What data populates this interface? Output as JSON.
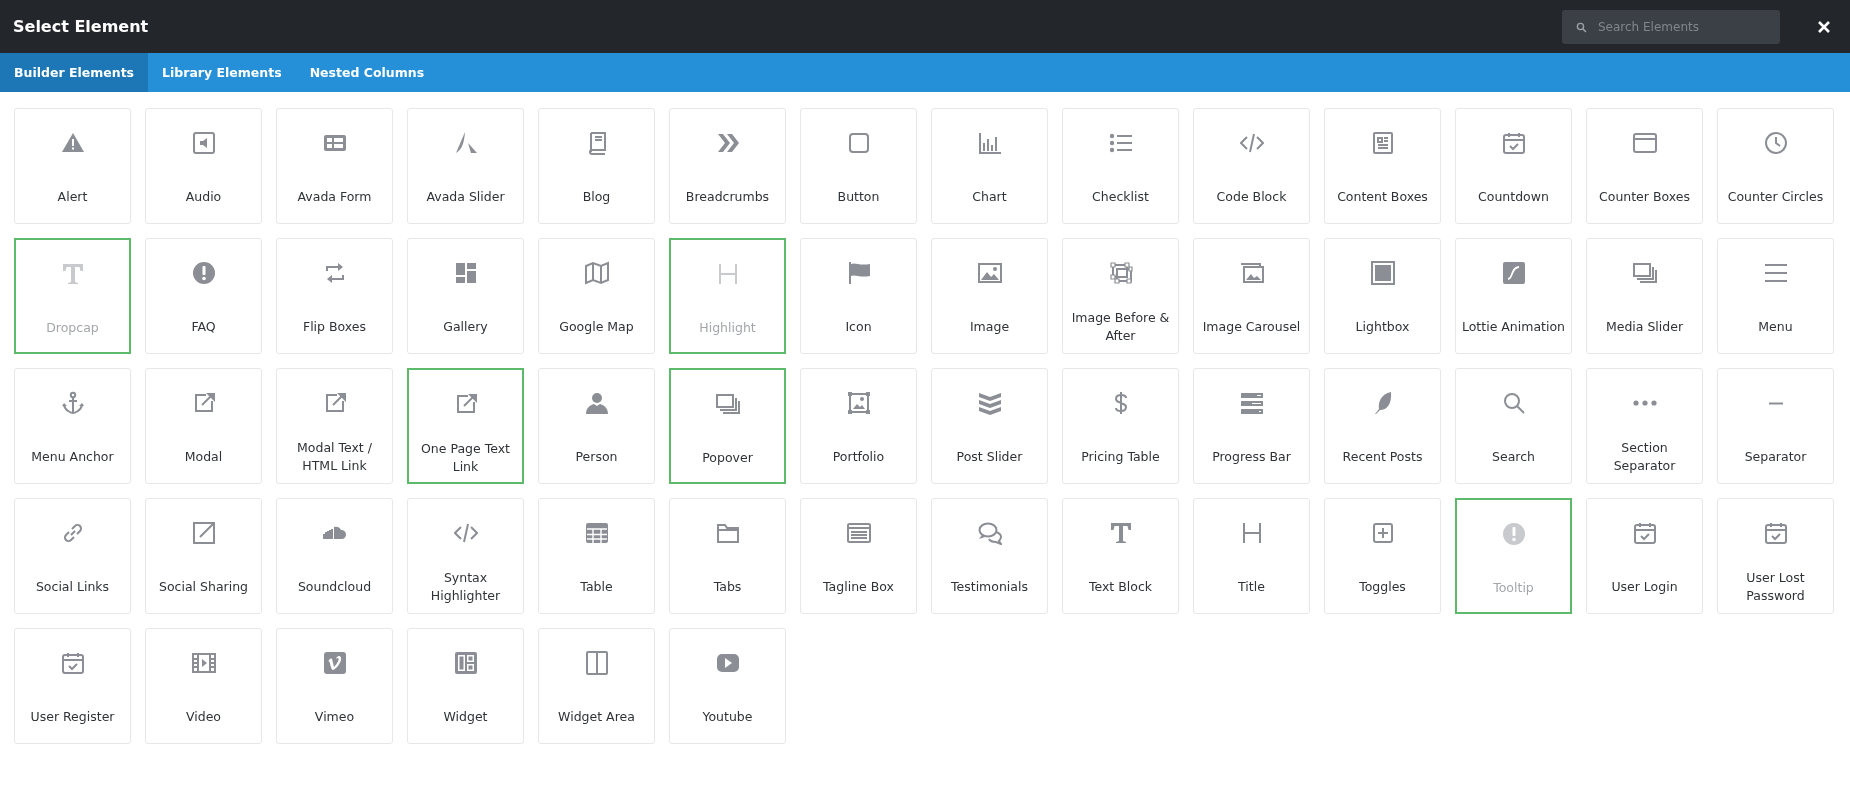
{
  "window": {
    "title": "Select Element"
  },
  "search": {
    "placeholder": "Search Elements"
  },
  "tabs": [
    {
      "label": "Builder Elements",
      "selected": true
    },
    {
      "label": "Library Elements",
      "selected": false
    },
    {
      "label": "Nested Columns",
      "selected": false
    }
  ],
  "elements": [
    {
      "label": "Alert",
      "disabled": false,
      "highlighted": false
    },
    {
      "label": "Audio",
      "disabled": false,
      "highlighted": false
    },
    {
      "label": "Avada Form",
      "disabled": false,
      "highlighted": false
    },
    {
      "label": "Avada Slider",
      "disabled": false,
      "highlighted": false
    },
    {
      "label": "Blog",
      "disabled": false,
      "highlighted": false
    },
    {
      "label": "Breadcrumbs",
      "disabled": false,
      "highlighted": false
    },
    {
      "label": "Button",
      "disabled": false,
      "highlighted": false
    },
    {
      "label": "Chart",
      "disabled": false,
      "highlighted": false
    },
    {
      "label": "Checklist",
      "disabled": false,
      "highlighted": false
    },
    {
      "label": "Code Block",
      "disabled": false,
      "highlighted": false
    },
    {
      "label": "Content Boxes",
      "disabled": false,
      "highlighted": false
    },
    {
      "label": "Countdown",
      "disabled": false,
      "highlighted": false
    },
    {
      "label": "Counter Boxes",
      "disabled": false,
      "highlighted": false
    },
    {
      "label": "Counter Circles",
      "disabled": false,
      "highlighted": false
    },
    {
      "label": "Dropcap",
      "disabled": true,
      "highlighted": true
    },
    {
      "label": "FAQ",
      "disabled": false,
      "highlighted": false
    },
    {
      "label": "Flip Boxes",
      "disabled": false,
      "highlighted": false
    },
    {
      "label": "Gallery",
      "disabled": false,
      "highlighted": false
    },
    {
      "label": "Google Map",
      "disabled": false,
      "highlighted": false
    },
    {
      "label": "Highlight",
      "disabled": true,
      "highlighted": true
    },
    {
      "label": "Icon",
      "disabled": false,
      "highlighted": false
    },
    {
      "label": "Image",
      "disabled": false,
      "highlighted": false
    },
    {
      "label": "Image Before & After",
      "disabled": false,
      "highlighted": false
    },
    {
      "label": "Image Carousel",
      "disabled": false,
      "highlighted": false
    },
    {
      "label": "Lightbox",
      "disabled": false,
      "highlighted": false
    },
    {
      "label": "Lottie Animation",
      "disabled": false,
      "highlighted": false
    },
    {
      "label": "Media Slider",
      "disabled": false,
      "highlighted": false
    },
    {
      "label": "Menu",
      "disabled": false,
      "highlighted": false
    },
    {
      "label": "Menu Anchor",
      "disabled": false,
      "highlighted": false
    },
    {
      "label": "Modal",
      "disabled": false,
      "highlighted": false
    },
    {
      "label": "Modal Text / HTML Link",
      "disabled": false,
      "highlighted": false
    },
    {
      "label": "One Page Text Link",
      "disabled": false,
      "highlighted": true
    },
    {
      "label": "Person",
      "disabled": false,
      "highlighted": false
    },
    {
      "label": "Popover",
      "disabled": false,
      "highlighted": true
    },
    {
      "label": "Portfolio",
      "disabled": false,
      "highlighted": false
    },
    {
      "label": "Post Slider",
      "disabled": false,
      "highlighted": false
    },
    {
      "label": "Pricing Table",
      "disabled": false,
      "highlighted": false
    },
    {
      "label": "Progress Bar",
      "disabled": false,
      "highlighted": false
    },
    {
      "label": "Recent Posts",
      "disabled": false,
      "highlighted": false
    },
    {
      "label": "Search",
      "disabled": false,
      "highlighted": false
    },
    {
      "label": "Section Separator",
      "disabled": false,
      "highlighted": false
    },
    {
      "label": "Separator",
      "disabled": false,
      "highlighted": false
    },
    {
      "label": "Social Links",
      "disabled": false,
      "highlighted": false
    },
    {
      "label": "Social Sharing",
      "disabled": false,
      "highlighted": false
    },
    {
      "label": "Soundcloud",
      "disabled": false,
      "highlighted": false
    },
    {
      "label": "Syntax Highlighter",
      "disabled": false,
      "highlighted": false
    },
    {
      "label": "Table",
      "disabled": false,
      "highlighted": false
    },
    {
      "label": "Tabs",
      "disabled": false,
      "highlighted": false
    },
    {
      "label": "Tagline Box",
      "disabled": false,
      "highlighted": false
    },
    {
      "label": "Testimonials",
      "disabled": false,
      "highlighted": false
    },
    {
      "label": "Text Block",
      "disabled": false,
      "highlighted": false
    },
    {
      "label": "Title",
      "disabled": false,
      "highlighted": false
    },
    {
      "label": "Toggles",
      "disabled": false,
      "highlighted": false
    },
    {
      "label": "Tooltip",
      "disabled": true,
      "highlighted": true
    },
    {
      "label": "User Login",
      "disabled": false,
      "highlighted": false
    },
    {
      "label": "User Lost Password",
      "disabled": false,
      "highlighted": false
    },
    {
      "label": "User Register",
      "disabled": false,
      "highlighted": false
    },
    {
      "label": "Video",
      "disabled": false,
      "highlighted": false
    },
    {
      "label": "Vimeo",
      "disabled": false,
      "highlighted": false
    },
    {
      "label": "Widget",
      "disabled": false,
      "highlighted": false
    },
    {
      "label": "Widget Area",
      "disabled": false,
      "highlighted": false
    },
    {
      "label": "Youtube",
      "disabled": false,
      "highlighted": false
    }
  ]
}
